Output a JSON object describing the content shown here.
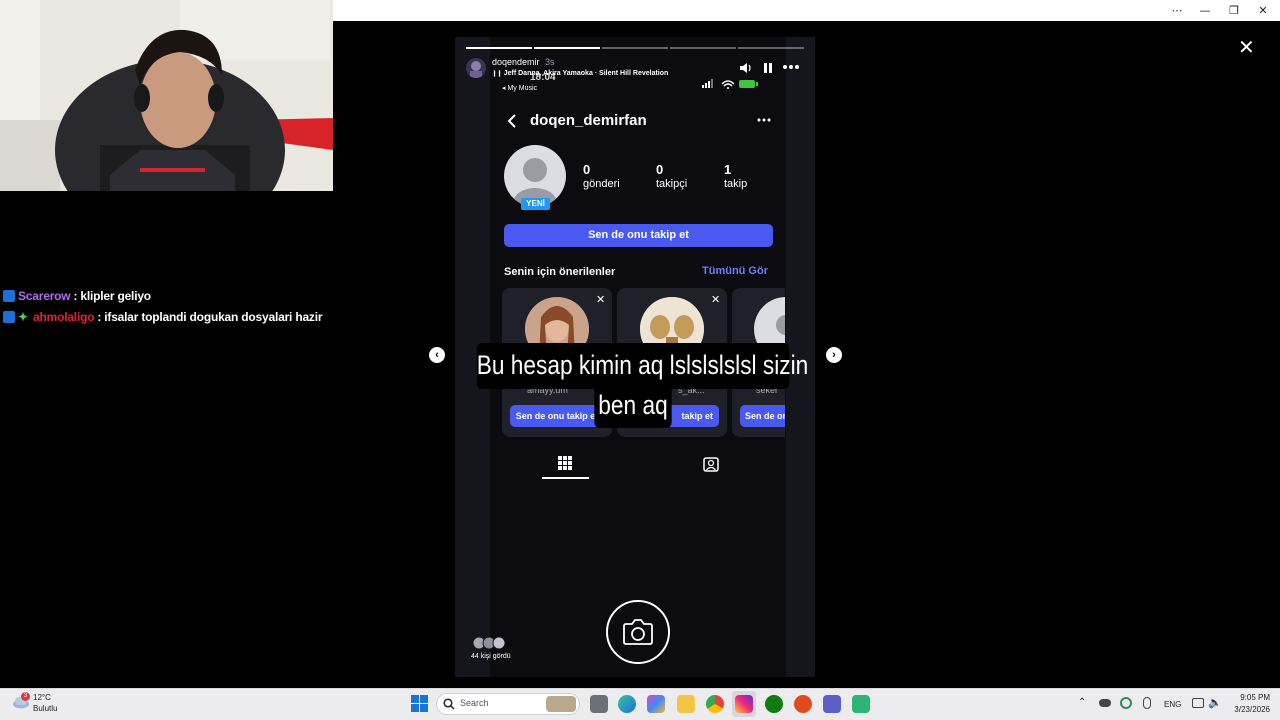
{
  "window": {
    "minimize": "⋯",
    "min2": "—",
    "restore": "❐",
    "close": "✕"
  },
  "chat": [
    {
      "user": "Scarerow",
      "user_color": "#b36cf0",
      "message": ": klipler geliyo"
    },
    {
      "user": "ahmolaligo",
      "user_color": "#e0242d",
      "message": ": ifsalar toplandi dogukan dosyalari hazir"
    }
  ],
  "story": {
    "username": "doqendemir",
    "time": "3s",
    "music_label": "Jeff Danna, Akira Yamaoka · Silent Hill Revelation",
    "phone_time": "18:04",
    "back_app": "◂ My Music",
    "viewers": "44 kişi gördü",
    "close": "✕"
  },
  "profile": {
    "handle": "doqen_demirfan",
    "new_badge": "YENİ",
    "posts_count": "0",
    "posts_label": "gönderi",
    "followers_count": "0",
    "followers_label": "takipçi",
    "following_count": "1",
    "following_label": "takip",
    "follow_back": "Sen de onu takip et",
    "suggested_title": "Senin için önerilenler",
    "see_all": "Tümünü Gör",
    "cards": [
      {
        "name": "amayy.um",
        "button": "Sen de onu takip et"
      },
      {
        "name": "s_ak...",
        "button": "takip et"
      },
      {
        "name": "seker",
        "button": "Sen de on"
      }
    ]
  },
  "caption": {
    "line1": "Bu hesap kimin aq lslslslslsl sizin",
    "line2": "ben aq"
  },
  "taskbar": {
    "weather_temp": "12°C",
    "weather_desc": "Bulutlu",
    "weather_badge": "3",
    "search_placeholder": "Search",
    "lang": "ENG",
    "clock_time": "9:05 PM",
    "clock_date": "3/23/2026"
  }
}
